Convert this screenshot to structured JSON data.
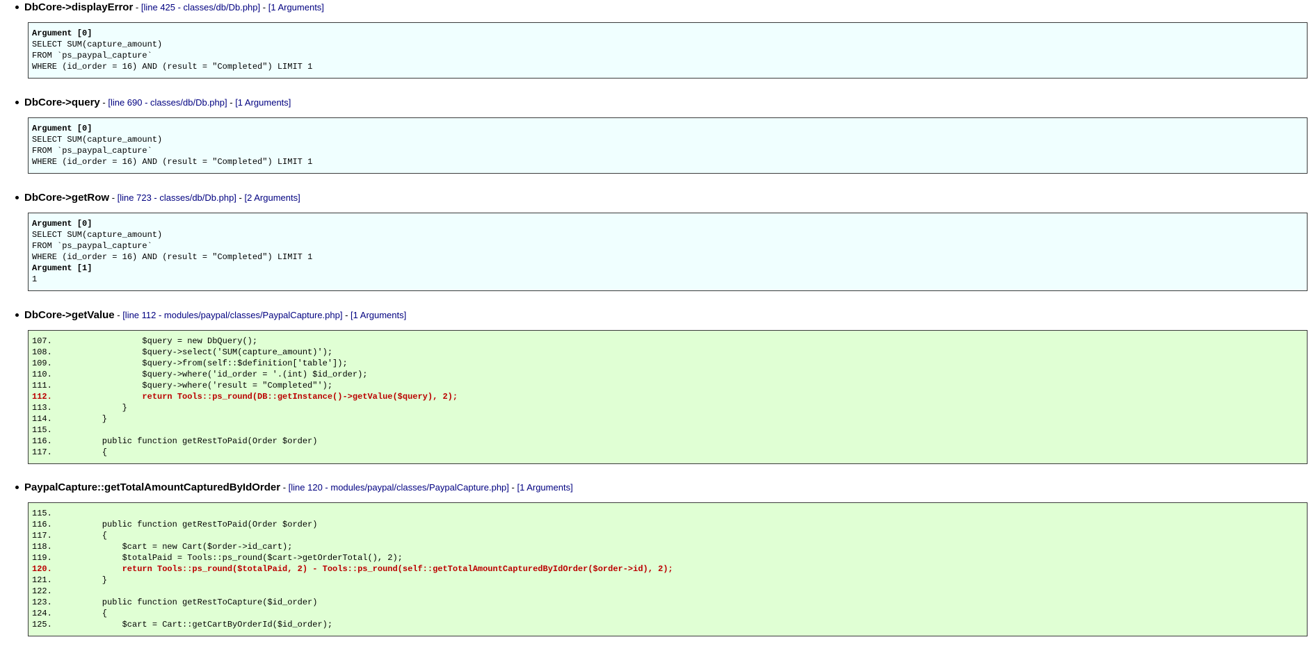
{
  "trace": [
    {
      "function": "DbCore->displayError",
      "location": "[line 425 - classes/db/Db.php]",
      "arg_count": "[1 Arguments]",
      "kind": "args",
      "rows": [
        {
          "type": "label",
          "text": "Argument [0]"
        },
        {
          "type": "value",
          "text": "SELECT SUM(capture_amount)"
        },
        {
          "type": "value",
          "text": "FROM `ps_paypal_capture`"
        },
        {
          "type": "value",
          "text": "WHERE (id_order = 16) AND (result = \"Completed\") LIMIT 1"
        }
      ]
    },
    {
      "function": "DbCore->query",
      "location": "[line 690 - classes/db/Db.php]",
      "arg_count": "[1 Arguments]",
      "kind": "args",
      "rows": [
        {
          "type": "label",
          "text": "Argument [0]"
        },
        {
          "type": "value",
          "text": "SELECT SUM(capture_amount)"
        },
        {
          "type": "value",
          "text": "FROM `ps_paypal_capture`"
        },
        {
          "type": "value",
          "text": "WHERE (id_order = 16) AND (result = \"Completed\") LIMIT 1"
        }
      ]
    },
    {
      "function": "DbCore->getRow",
      "location": "[line 723 - classes/db/Db.php]",
      "arg_count": "[2 Arguments]",
      "kind": "args",
      "rows": [
        {
          "type": "label",
          "text": "Argument [0]"
        },
        {
          "type": "value",
          "text": "SELECT SUM(capture_amount)"
        },
        {
          "type": "value",
          "text": "FROM `ps_paypal_capture`"
        },
        {
          "type": "value",
          "text": "WHERE (id_order = 16) AND (result = \"Completed\") LIMIT 1"
        },
        {
          "type": "label",
          "text": "Argument [1]"
        },
        {
          "type": "value",
          "text": "1"
        }
      ]
    },
    {
      "function": "DbCore->getValue",
      "location": "[line 112 - modules/paypal/classes/PaypalCapture.php]",
      "arg_count": "[1 Arguments]",
      "kind": "source",
      "rows": [
        {
          "num": "107.",
          "code": "            $query = new DbQuery();",
          "highlight": false
        },
        {
          "num": "108.",
          "code": "            $query->select('SUM(capture_amount)');",
          "highlight": false
        },
        {
          "num": "109.",
          "code": "            $query->from(self::$definition['table']);",
          "highlight": false
        },
        {
          "num": "110.",
          "code": "            $query->where('id_order = '.(int) $id_order);",
          "highlight": false
        },
        {
          "num": "111.",
          "code": "            $query->where('result = \"Completed\"');",
          "highlight": false
        },
        {
          "num": "112.",
          "code": "            return Tools::ps_round(DB::getInstance()->getValue($query), 2);",
          "highlight": true
        },
        {
          "num": "113.",
          "code": "        }",
          "highlight": false
        },
        {
          "num": "114.",
          "code": "    }",
          "highlight": false
        },
        {
          "num": "115.",
          "code": "",
          "highlight": false
        },
        {
          "num": "116.",
          "code": "    public function getRestToPaid(Order $order)",
          "highlight": false
        },
        {
          "num": "117.",
          "code": "    {",
          "highlight": false
        }
      ]
    },
    {
      "function": "PaypalCapture::getTotalAmountCapturedByIdOrder",
      "location": "[line 120 - modules/paypal/classes/PaypalCapture.php]",
      "arg_count": "[1 Arguments]",
      "kind": "source",
      "rows": [
        {
          "num": "115.",
          "code": "",
          "highlight": false
        },
        {
          "num": "116.",
          "code": "    public function getRestToPaid(Order $order)",
          "highlight": false
        },
        {
          "num": "117.",
          "code": "    {",
          "highlight": false
        },
        {
          "num": "118.",
          "code": "        $cart = new Cart($order->id_cart);",
          "highlight": false
        },
        {
          "num": "119.",
          "code": "        $totalPaid = Tools::ps_round($cart->getOrderTotal(), 2);",
          "highlight": false
        },
        {
          "num": "120.",
          "code": "        return Tools::ps_round($totalPaid, 2) - Tools::ps_round(self::getTotalAmountCapturedByIdOrder($order->id), 2);",
          "highlight": true
        },
        {
          "num": "121.",
          "code": "    }",
          "highlight": false
        },
        {
          "num": "122.",
          "code": "",
          "highlight": false
        },
        {
          "num": "123.",
          "code": "    public function getRestToCapture($id_order)",
          "highlight": false
        },
        {
          "num": "124.",
          "code": "    {",
          "highlight": false
        },
        {
          "num": "125.",
          "code": "        $cart = Cart::getCartByOrderId($id_order);",
          "highlight": false
        }
      ]
    }
  ],
  "separator": " - ",
  "colors": {
    "args_background": "#f0ffff",
    "source_background": "#e0ffd4",
    "highlight_text": "#bb0000",
    "meta_text": "#000080"
  }
}
